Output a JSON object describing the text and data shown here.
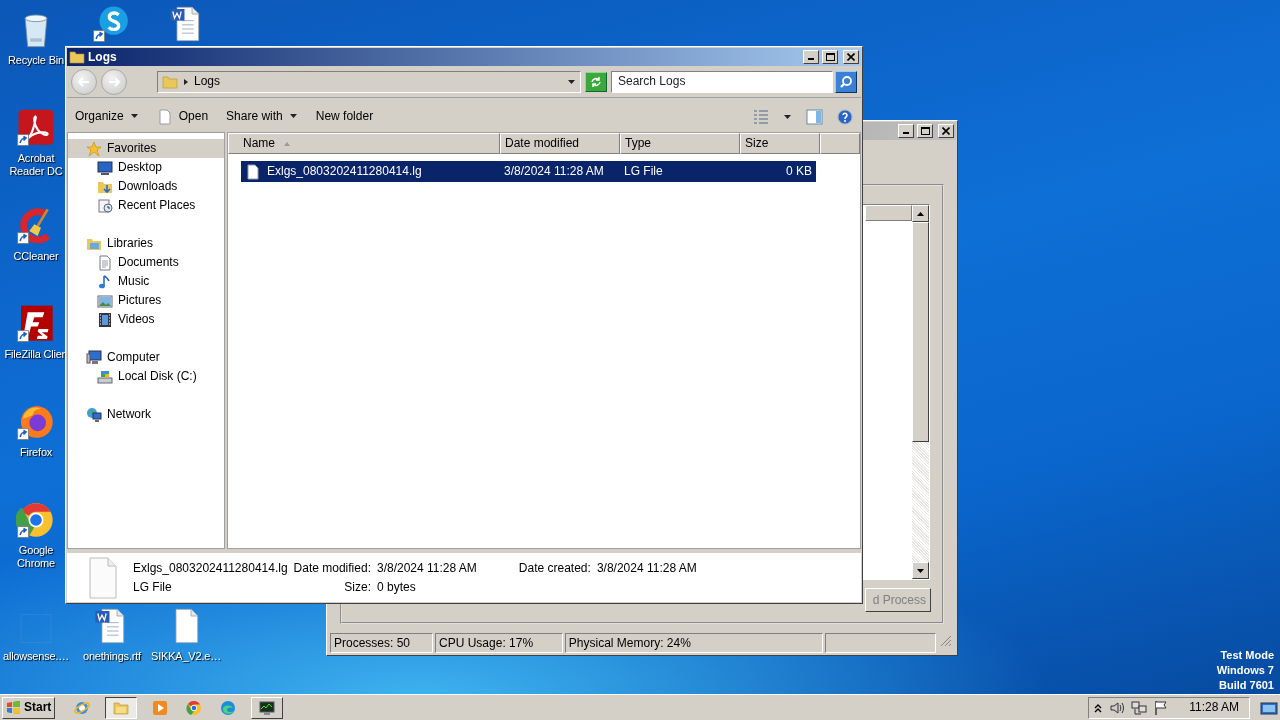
{
  "desktop_icons": [
    {
      "kind": "bin",
      "label": "Recycle Bin",
      "shortcut": false
    },
    {
      "kind": "skype",
      "shortcut": true
    },
    {
      "kind": "doc",
      "shortcut": false
    },
    {
      "kind": "acrobat",
      "label": "Acrobat Reader DC",
      "shortcut": true
    },
    {
      "kind": "ccleaner",
      "label": "CCleaner",
      "shortcut": true
    },
    {
      "kind": "filezilla",
      "label": "FileZilla Clien",
      "shortcut": true
    },
    {
      "kind": "firefox",
      "label": "Firefox",
      "shortcut": true
    },
    {
      "kind": "chrome",
      "label": "Google Chrome",
      "shortcut": true
    },
    {
      "kind": "blank",
      "label": "allowsense.…",
      "shortcut": false
    },
    {
      "kind": "doc",
      "label": "onethings.rtf",
      "shortcut": false
    },
    {
      "kind": "page",
      "label": "SIKKA_V2.e…",
      "shortcut": false
    }
  ],
  "task_manager": {
    "button": "d Process",
    "status": [
      "Processes: 50",
      "CPU Usage: 17%",
      "Physical Memory: 24%"
    ]
  },
  "explorer": {
    "title": "Logs",
    "address": "Logs",
    "search": {
      "placeholder": "Search Logs"
    },
    "commands": [
      {
        "kind": "menu",
        "label": "Organize"
      },
      {
        "kind": "file",
        "label": "Open"
      },
      {
        "kind": "menu",
        "label": "Share with"
      },
      {
        "kind": "plain",
        "label": "New folder"
      }
    ],
    "nav": [
      {
        "kind": "star",
        "label": "Favorites",
        "selected": true,
        "children": [
          {
            "kind": "desktop",
            "label": "Desktop",
            "selected": false
          },
          {
            "kind": "downloads",
            "label": "Downloads",
            "selected": false
          },
          {
            "kind": "recent",
            "label": "Recent Places",
            "selected": false
          }
        ]
      },
      {
        "kind": "library",
        "label": "Libraries",
        "selected": false,
        "children": [
          {
            "kind": "documents",
            "label": "Documents",
            "selected": false
          },
          {
            "kind": "music",
            "label": "Music",
            "selected": false
          },
          {
            "kind": "pictures",
            "label": "Pictures",
            "selected": false
          },
          {
            "kind": "videos",
            "label": "Videos",
            "selected": false
          }
        ]
      },
      {
        "kind": "computer",
        "label": "Computer",
        "selected": false,
        "children": [
          {
            "kind": "disk",
            "label": "Local Disk (C:)",
            "selected": false
          }
        ]
      },
      {
        "kind": "network",
        "label": "Network",
        "selected": false
      }
    ],
    "columns": [
      {
        "label": "Name",
        "sorted": true
      },
      {
        "label": "Date modified",
        "sorted": false
      },
      {
        "label": "Type",
        "sorted": false
      },
      {
        "label": "Size",
        "sorted": false
      }
    ],
    "files": [
      {
        "name": "Exlgs_0803202411280414.lg",
        "date": "3/8/2024 11:28 AM",
        "type": "LG File",
        "size": "0 KB",
        "selected": true
      }
    ],
    "details": {
      "name": "Exlgs_0803202411280414.lg",
      "type": "LG File",
      "fields": [
        {
          "label": "Date modified:",
          "value": "3/8/2024 11:28 AM"
        },
        {
          "label": "Size:",
          "value": "0 bytes"
        },
        {
          "label": "Date created:",
          "value": "3/8/2024 11:28 AM"
        }
      ]
    }
  },
  "taskbar": {
    "start": "Start",
    "apps": [
      {
        "kind": "ie",
        "running": false,
        "active": false
      },
      {
        "kind": "explorer",
        "running": true,
        "active": true
      },
      {
        "kind": "media",
        "running": false,
        "active": false
      },
      {
        "kind": "chrome",
        "running": false,
        "active": false
      },
      {
        "kind": "edge",
        "running": false,
        "active": false
      },
      {
        "kind": "taskmgr",
        "running": true,
        "active": false
      }
    ],
    "clock": "11:28 AM"
  },
  "notice": [
    "Test Mode",
    "Windows 7",
    "Build 7601"
  ]
}
